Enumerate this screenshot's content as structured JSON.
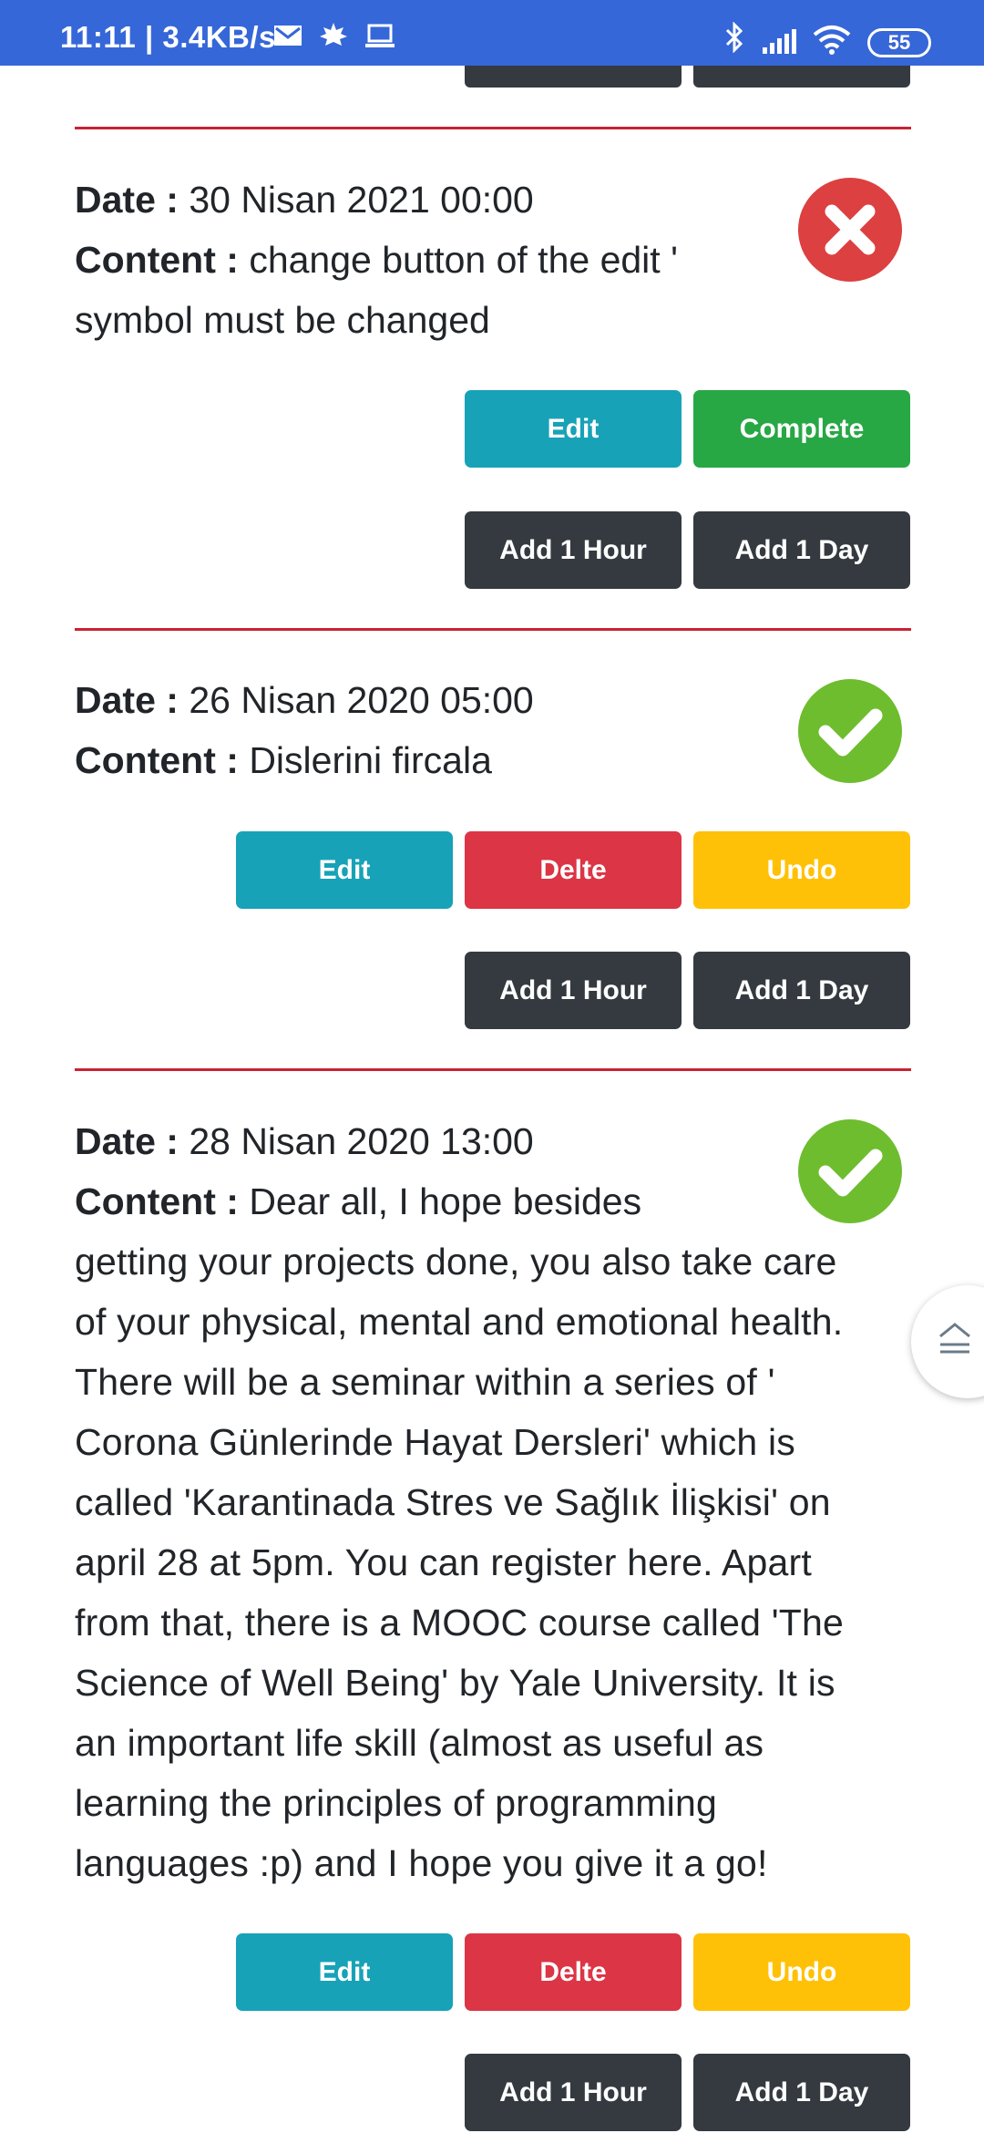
{
  "status_bar": {
    "time": "11:11",
    "speed": "| 3.4KB/s",
    "battery": "55"
  },
  "labels": {
    "date": "Date :",
    "content": "Content :"
  },
  "todos": [
    {
      "date": "30 Nisan 2021 00:00",
      "content_first": "change button of the edit '",
      "content_rest": "symbol must be changed",
      "status": "incomplete",
      "buttons": {
        "edit": "Edit",
        "complete": "Complete",
        "add_hour": "Add 1 Hour",
        "add_day": "Add 1 Day"
      }
    },
    {
      "date": "26 Nisan 2020 05:00",
      "content_first": "Dislerini fircala",
      "status": "complete",
      "buttons": {
        "edit": "Edit",
        "delete": "Delte",
        "undo": "Undo",
        "add_hour": "Add 1 Hour",
        "add_day": "Add 1 Day"
      }
    },
    {
      "date": "28 Nisan 2020 13:00",
      "content_first": "Dear all, I hope besides",
      "content_lines": [
        "getting your projects done, you also take care",
        "of your physical, mental and emotional health.",
        "There will be a seminar within a series of '",
        "Corona Günlerinde Hayat Dersleri' which is",
        "called 'Karantinada Stres ve Sağlık İlişkisi' on",
        "april 28 at 5pm. You can register here. Apart",
        "from that, there is a MOOC course called 'The",
        "Science of Well Being' by Yale University. It is",
        "an important life skill (almost as useful as",
        "learning the principles of programming",
        "languages :p) and I hope you give it a go!"
      ],
      "status": "complete",
      "buttons": {
        "edit": "Edit",
        "delete": "Delte",
        "undo": "Undo",
        "add_hour": "Add 1 Hour",
        "add_day": "Add 1 Day"
      }
    }
  ],
  "colors": {
    "status_bar": "#3667d8",
    "divider": "#c82333",
    "edit": "#17a2b8",
    "complete": "#28a745",
    "delete": "#dc3545",
    "undo": "#ffc107",
    "dark": "#343a40",
    "check": "#6ebd2f",
    "cross": "#dc4040"
  }
}
